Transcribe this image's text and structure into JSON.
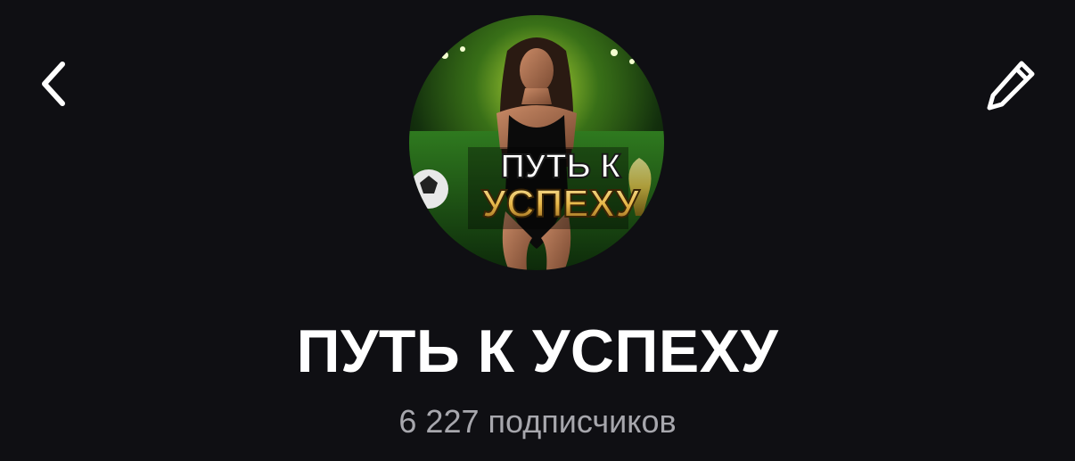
{
  "header": {
    "back_icon": "chevron-left-icon",
    "edit_icon": "pencil-icon"
  },
  "channel": {
    "avatar_text_line1": "ПУТЬ К",
    "avatar_text_line2": "УСПЕХУ",
    "title": "ПУТЬ К УСПЕХУ",
    "subscribers": "6 227 подписчиков"
  },
  "colors": {
    "background": "#0f0f13",
    "title": "#ffffff",
    "subtitle": "#a7a7ad",
    "avatar_accent": "#c9f23a",
    "avatar_gold": "#e8b84a"
  }
}
